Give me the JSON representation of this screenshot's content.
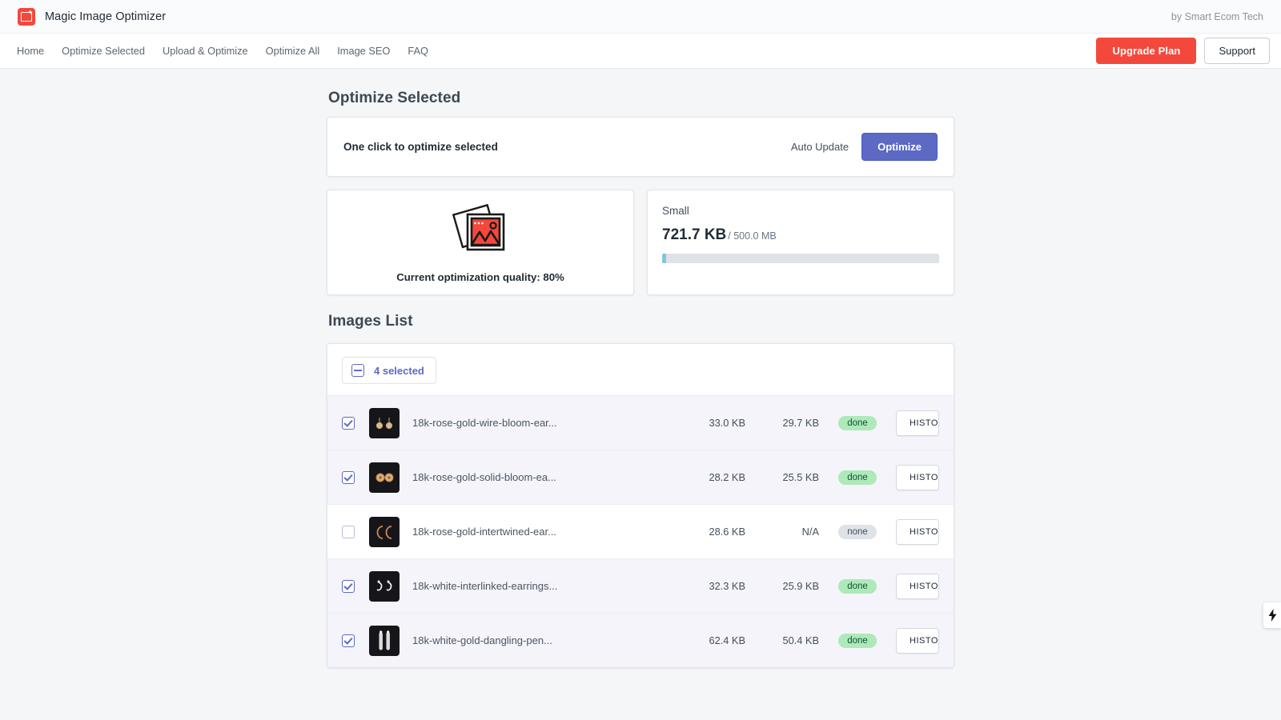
{
  "topbar": {
    "brand_name": "Magic Image Optimizer",
    "logo_icon": "image-logo-icon",
    "credit": "by Smart Ecom Tech"
  },
  "nav": {
    "items": [
      {
        "label": "Home",
        "name": "nav-item-home"
      },
      {
        "label": "Optimize Selected",
        "name": "nav-item-optimize-selected"
      },
      {
        "label": "Upload & Optimize",
        "name": "nav-item-upload-optimize"
      },
      {
        "label": "Optimize All",
        "name": "nav-item-optimize-all"
      },
      {
        "label": "Image SEO",
        "name": "nav-item-image-seo"
      },
      {
        "label": "FAQ",
        "name": "nav-item-faq"
      }
    ],
    "upgrade_label": "Upgrade Plan",
    "support_label": "Support"
  },
  "page": {
    "title": "Optimize Selected"
  },
  "optimize_bar": {
    "label": "One click to optimize selected",
    "auto_update_label": "Auto Update",
    "optimize_label": "Optimize"
  },
  "quality_card": {
    "icon": "photo-stack-icon",
    "text": "Current optimization quality: 80%"
  },
  "storage_card": {
    "plan": "Small",
    "used": "721.7 KB",
    "total": "/ 500.0 MB",
    "percent": 0.14
  },
  "images_list": {
    "title": "Images List",
    "selected_chip": "4 selected",
    "select_icon": "checkbox-indeterminate-icon",
    "rows": [
      {
        "checked": true,
        "filename": "18k-rose-gold-wire-bloom-ear...",
        "original_size": "33.0 KB",
        "optimized_size": "29.7 KB",
        "status": "done",
        "action_label": "HISTORY",
        "thumb": "earrings-wire-bloom"
      },
      {
        "checked": true,
        "filename": "18k-rose-gold-solid-bloom-ea...",
        "original_size": "28.2 KB",
        "optimized_size": "25.5 KB",
        "status": "done",
        "action_label": "HISTORY",
        "thumb": "earrings-solid-bloom"
      },
      {
        "checked": false,
        "filename": "18k-rose-gold-intertwined-ear...",
        "original_size": "28.6 KB",
        "optimized_size": "N/A",
        "status": "none",
        "action_label": "HISTORY",
        "thumb": "earrings-intertwined"
      },
      {
        "checked": true,
        "filename": "18k-white-interlinked-earrings...",
        "original_size": "32.3 KB",
        "optimized_size": "25.9 KB",
        "status": "done",
        "action_label": "HISTORY",
        "thumb": "earrings-interlinked"
      },
      {
        "checked": true,
        "filename": "18k-white-gold-dangling-pen...",
        "original_size": "62.4 KB",
        "optimized_size": "50.4 KB",
        "status": "done",
        "action_label": "HISTORY",
        "thumb": "pendant-dangling"
      }
    ]
  },
  "side_tab": {
    "icon": "lightning-bolt-icon"
  },
  "colors": {
    "brand_red": "#f4483c",
    "primary_indigo": "#5c6ac4",
    "badge_done_bg": "#aee9b9",
    "badge_none_bg": "#dfe3e8",
    "progress_fill": "#7fc9d6",
    "page_bg": "#f4f6f8"
  }
}
